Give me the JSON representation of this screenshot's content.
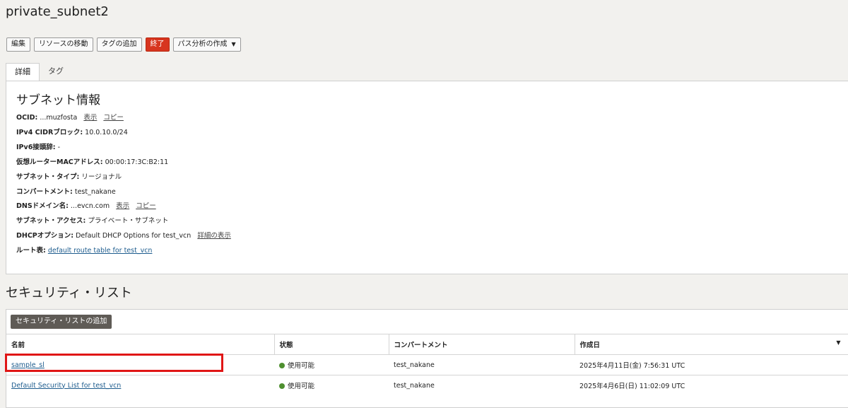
{
  "page": {
    "title": "private_subnet2"
  },
  "toolbar": {
    "edit": "編集",
    "move": "リソースの移動",
    "add_tag": "タグの追加",
    "terminate": "終了",
    "path_analysis": "パス分析の作成"
  },
  "tabs": {
    "details": "詳細",
    "tags": "タグ"
  },
  "subnet_info": {
    "title": "サブネット情報",
    "ocid": {
      "label": "OCID:",
      "value": "...muzfosta",
      "show": "表示",
      "copy": "コピー"
    },
    "ipv4": {
      "label": "IPv4 CIDRブロック:",
      "value": "10.0.10.0/24"
    },
    "ipv6": {
      "label": "IPv6接頭辞:",
      "value": "-"
    },
    "mac": {
      "label": "仮想ルーターMACアドレス:",
      "value": "00:00:17:3C:B2:11"
    },
    "type": {
      "label": "サブネット・タイプ:",
      "value": "リージョナル"
    },
    "compartment": {
      "label": "コンパートメント:",
      "value": "test_nakane"
    },
    "dns": {
      "label": "DNSドメイン名:",
      "value": "...evcn.com",
      "show": "表示",
      "copy": "コピー"
    },
    "access": {
      "label": "サブネット・アクセス:",
      "value": "プライベート・サブネット"
    },
    "dhcp": {
      "label": "DHCPオプション:",
      "value": "Default DHCP Options for test_vcn",
      "detail": "詳細の表示"
    },
    "route": {
      "label": "ルート表:",
      "value": "default route table for test_vcn"
    }
  },
  "security_lists": {
    "title": "セキュリティ・リスト",
    "add_button": "セキュリティ・リストの追加",
    "columns": {
      "name": "名前",
      "state": "状態",
      "compartment": "コンパートメント",
      "created": "作成日"
    },
    "rows": [
      {
        "name": "sample_sl",
        "state": "使用可能",
        "compartment": "test_nakane",
        "created": "2025年4月11日(金) 7:56:31 UTC"
      },
      {
        "name": "Default Security List for test_vcn",
        "state": "使用可能",
        "compartment": "test_nakane",
        "created": "2025年4月6日(日) 11:02:09 UTC"
      }
    ]
  }
}
